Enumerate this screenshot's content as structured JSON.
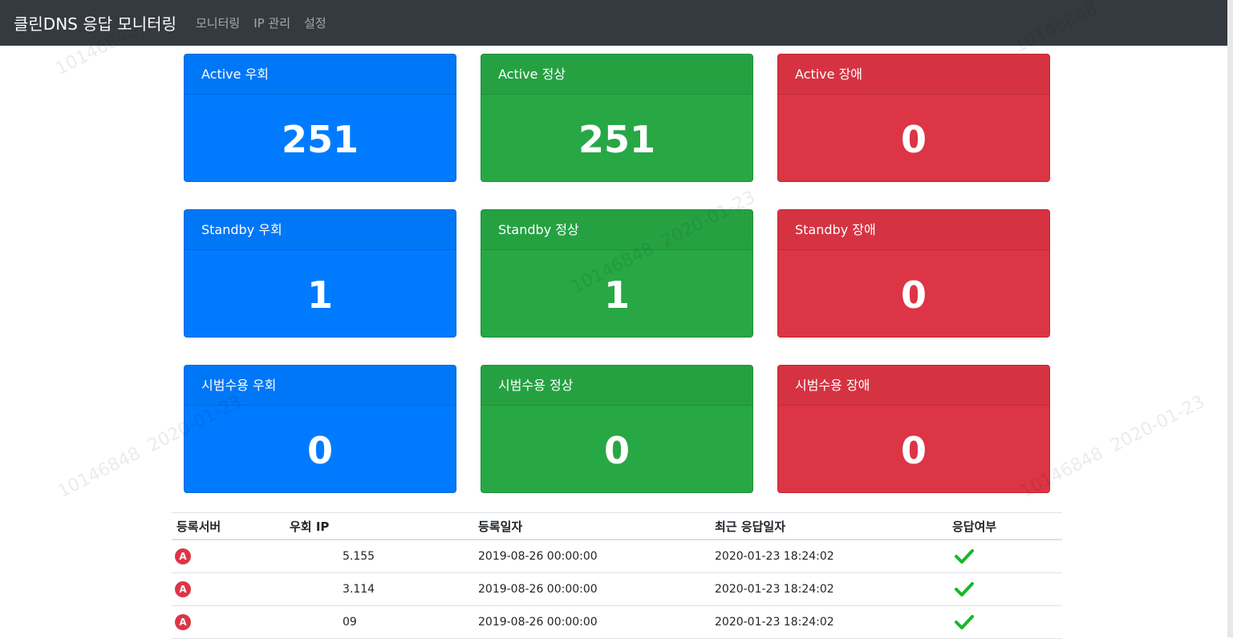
{
  "navbar": {
    "brand": "클린DNS 응답 모니터링",
    "links": [
      "모니터링",
      "IP 관리",
      "설정"
    ]
  },
  "cards": [
    {
      "title": "Active 우회",
      "value": "251",
      "color": "#007bff"
    },
    {
      "title": "Active 정상",
      "value": "251",
      "color": "#28a745"
    },
    {
      "title": "Active 장애",
      "value": "0",
      "color": "#dc3545"
    },
    {
      "title": "Standby 우회",
      "value": "1",
      "color": "#007bff"
    },
    {
      "title": "Standby 정상",
      "value": "1",
      "color": "#28a745"
    },
    {
      "title": "Standby 장애",
      "value": "0",
      "color": "#dc3545"
    },
    {
      "title": "시범수용 우회",
      "value": "0",
      "color": "#007bff"
    },
    {
      "title": "시범수용 정상",
      "value": "0",
      "color": "#28a745"
    },
    {
      "title": "시범수용 장애",
      "value": "0",
      "color": "#dc3545"
    }
  ],
  "table": {
    "headers": [
      "등록서버",
      "우회 IP",
      "등록일자",
      "최근 응답일자",
      "응답여부"
    ],
    "rows": [
      {
        "server_icon": "A",
        "ip": "5.155",
        "registered": "2019-08-26 00:00:00",
        "last_response": "2020-01-23 18:24:02",
        "status_icon": "check-icon"
      },
      {
        "server_icon": "A",
        "ip": "3.114",
        "registered": "2019-08-26 00:00:00",
        "last_response": "2020-01-23 18:24:02",
        "status_icon": "check-icon"
      },
      {
        "server_icon": "A",
        "ip": "09",
        "registered": "2019-08-26 00:00:00",
        "last_response": "2020-01-23 18:24:02",
        "status_icon": "check-icon"
      }
    ]
  },
  "watermark": {
    "id": "10146848",
    "date": "2020-01-23"
  },
  "colors": {
    "navbar": "#343a40",
    "blue": "#007bff",
    "green": "#28a745",
    "red": "#dc3545",
    "check": "#28a745"
  }
}
